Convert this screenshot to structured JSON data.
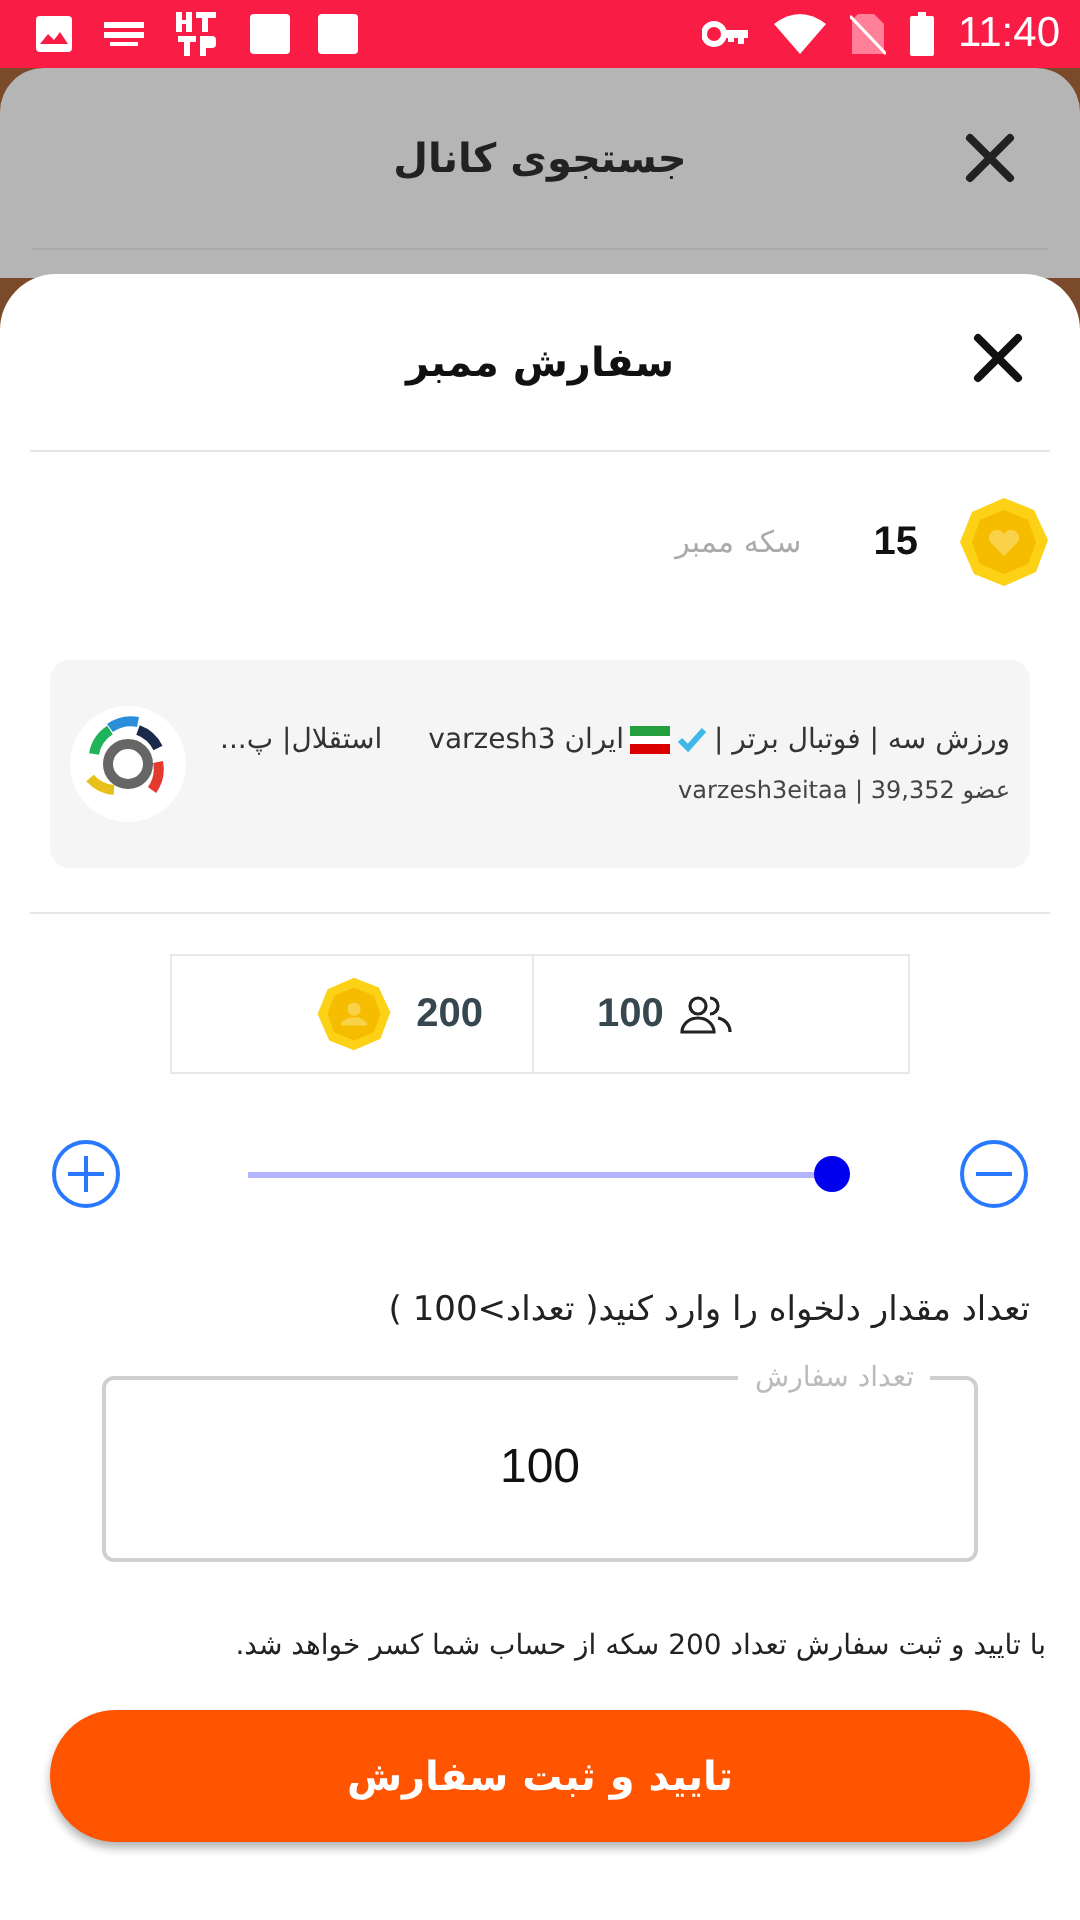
{
  "status_bar": {
    "time": "11:40"
  },
  "background_dialog": {
    "title": "جستجوی کانال"
  },
  "sheet": {
    "title": "سفارش ممبر"
  },
  "balance": {
    "amount": "15",
    "label": "سکه ممبر"
  },
  "channel": {
    "title_parts": [
      "ورزش سه | فوتبال برتر |",
      "ایران varzesh3",
      "استقلال| پ..."
    ],
    "subtitle": "عضو 39,352 | varzesh3eitaa"
  },
  "package": {
    "members": "100",
    "coins": "200"
  },
  "slider": {
    "level": 1.0
  },
  "prompt": "تعداد مقدار دلخواه را وارد کنید( تعداد>100 )",
  "order_field": {
    "label": "تعداد سفارش",
    "value": "100"
  },
  "note": "با تایید و ثبت سفارش تعداد 200 سکه از حساب شما کسر خواهد شد.",
  "confirm_button": "تایید و ثبت سفارش"
}
